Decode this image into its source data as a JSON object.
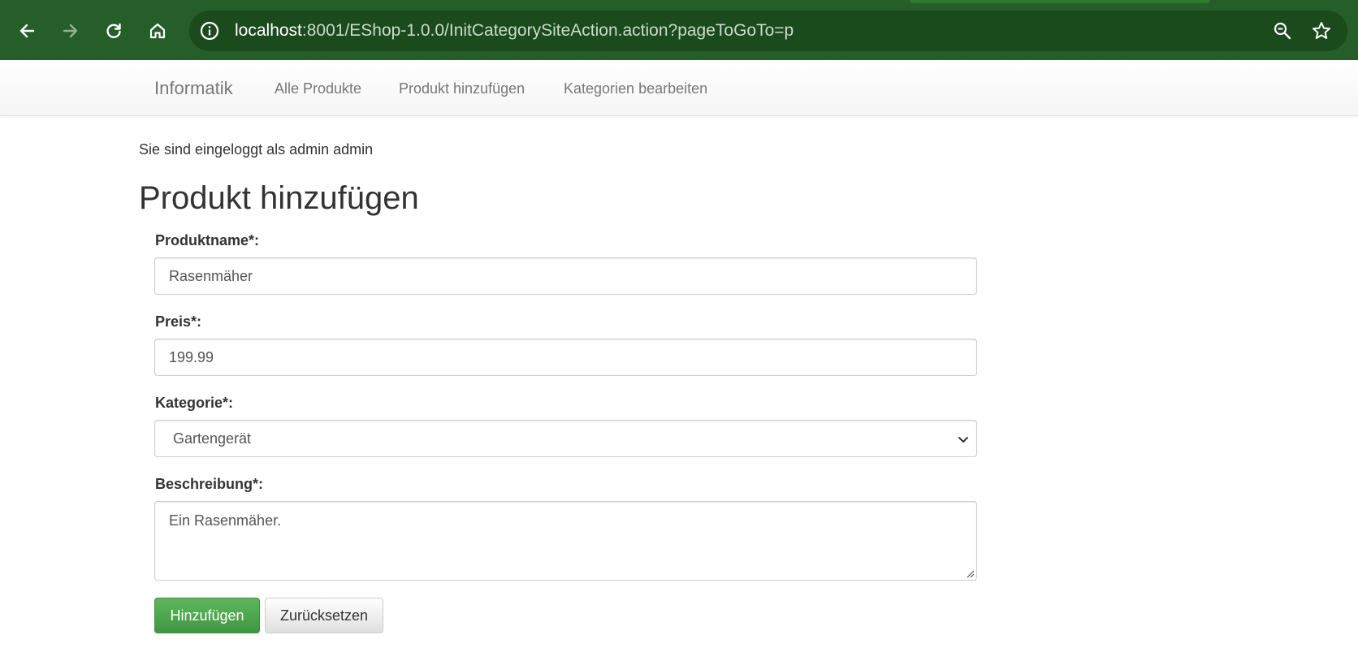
{
  "browser": {
    "url_host": "localhost",
    "url_rest": ":8001/EShop-1.0.0/InitCategorySiteAction.action?pageToGoTo=p",
    "theme_color": "#255e28"
  },
  "navbar": {
    "brand": "Informatik",
    "links": [
      "Alle Produkte",
      "Produkt hinzufügen",
      "Kategorien bearbeiten"
    ]
  },
  "login_info": "Sie sind eingeloggt als admin admin",
  "form": {
    "title": "Produkt hinzufügen",
    "name_label": "Produktname*:",
    "name_value": "Rasenmäher",
    "price_label": "Preis*:",
    "price_value": "199.99",
    "category_label": "Kategorie*:",
    "category_value": "Gartengerät",
    "description_label": "Beschreibung*:",
    "description_value": "Ein Rasenmäher.",
    "submit_label": "Hinzufügen",
    "reset_label": "Zurücksetzen"
  }
}
